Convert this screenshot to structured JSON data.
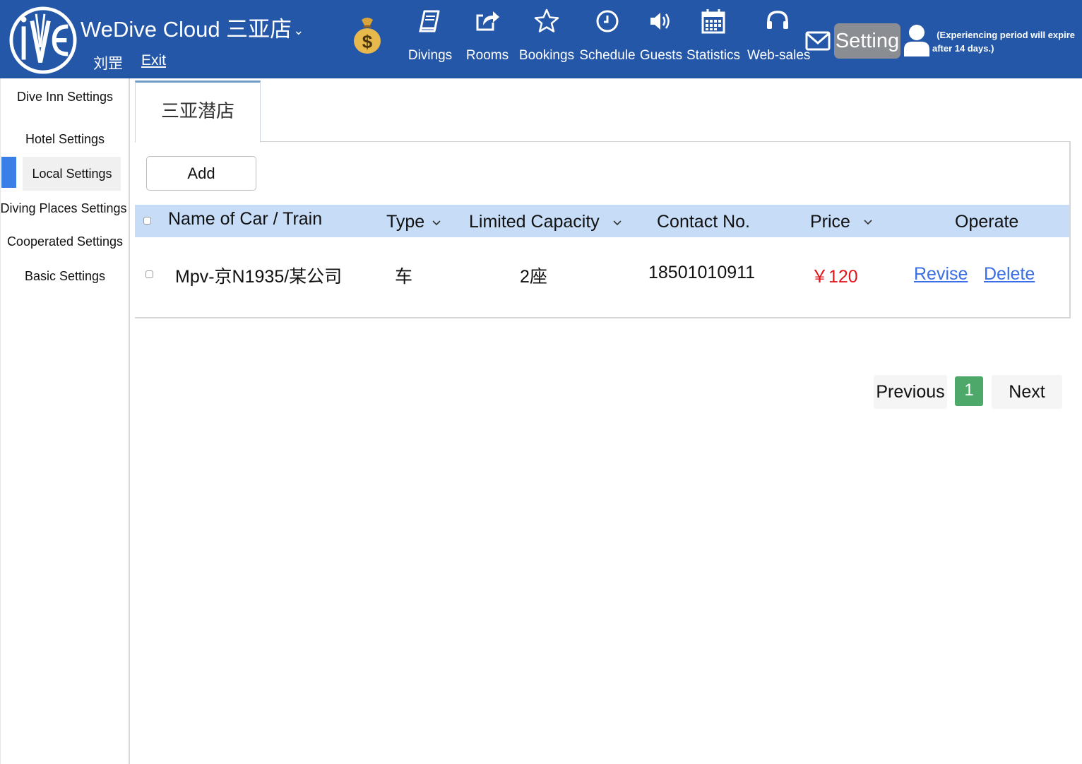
{
  "header": {
    "brand": "WeDive Cloud 三亚店",
    "brand_caret": "⌄",
    "user_name": "刘罡",
    "exit_label": "Exit",
    "nav": [
      {
        "label": "Divings",
        "icon": "book-icon"
      },
      {
        "label": "Rooms",
        "icon": "share-icon"
      },
      {
        "label": "Bookings",
        "icon": "star-icon"
      },
      {
        "label": "Schedule",
        "icon": "clock-icon"
      },
      {
        "label": "Guests",
        "icon": "speaker-icon"
      },
      {
        "label": "Statistics",
        "icon": "calendar-icon"
      },
      {
        "label": "Web-sales",
        "icon": "headset-icon"
      }
    ],
    "setting_label": "Setting",
    "expire_line1": "(Experiencing period will expire",
    "expire_line2": "after 14 days.)"
  },
  "sidebar": {
    "items": [
      {
        "label": "Dive Inn Settings"
      },
      {
        "label": "Hotel Settings"
      },
      {
        "label": "Local Settings",
        "active": true
      },
      {
        "label": "Diving Places Settings"
      },
      {
        "label": "Cooperated Settings"
      },
      {
        "label": "Basic Settings"
      }
    ]
  },
  "main": {
    "tab_label": "三亚潜店",
    "add_label": "Add",
    "columns": {
      "name": "Name of Car / Train",
      "type": "Type",
      "capacity": "Limited Capacity",
      "contact": "Contact No.",
      "price": "Price",
      "operate": "Operate"
    },
    "rows": [
      {
        "name": "Mpv-京N1935/某公司",
        "type": "车",
        "capacity": "2座",
        "contact": "18501010911",
        "price": "￥120",
        "revise": "Revise",
        "delete": "Delete"
      }
    ],
    "pagination": {
      "previous": "Previous",
      "current": "1",
      "next": "Next"
    }
  },
  "colors": {
    "header_bg": "#2457a7",
    "table_header_bg": "#c7dcf7",
    "active_sidebar_bar": "#3a7ee8",
    "price": "#e0161c",
    "link": "#3a6ee6",
    "current_page": "#4da86a",
    "setting_button": "#8a8d92"
  }
}
